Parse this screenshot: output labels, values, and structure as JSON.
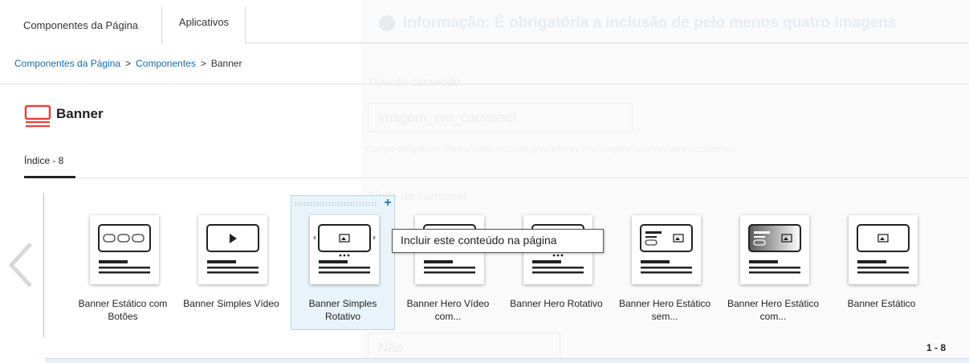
{
  "tabs": [
    {
      "label": "Componentes da Página"
    },
    {
      "label": "Aplicativos"
    }
  ],
  "breadcrumb": {
    "items": [
      "Componentes da Página",
      "Componentes"
    ],
    "current": "Banner",
    "separator": ">"
  },
  "page": {
    "title": "Banner",
    "index_label": "Índice - 8"
  },
  "carousel": {
    "items": [
      {
        "label": "Banner Estático com Botões",
        "icon": "banner-buttons-icon"
      },
      {
        "label": "Banner Simples Vídeo",
        "icon": "banner-video-icon"
      },
      {
        "label": "Banner Simples Rotativo",
        "icon": "banner-rotating-icon",
        "selected": true
      },
      {
        "label": "Banner Hero Vídeo com...",
        "icon": "banner-hero-video-icon"
      },
      {
        "label": "Banner Hero Rotativo",
        "icon": "banner-hero-rotating-icon"
      },
      {
        "label": "Banner Hero Estático sem...",
        "icon": "banner-hero-static-icon"
      },
      {
        "label": "Banner Hero Estático com...",
        "icon": "banner-hero-static-gradient-icon"
      },
      {
        "label": "Banner Estático",
        "icon": "banner-static-icon"
      }
    ],
    "pager": "1 - 8"
  },
  "tooltip": {
    "text": "Incluir este conteúdo na página"
  },
  "background_form": {
    "info": "Informação: É obrigatória a inclusão de pelo menos quatro imagens",
    "label1": "Tipo do conteúdo",
    "value1": "imagem_em_carrossel",
    "help": "Campo obrigatório. Para efetivar inclusão preencha as informações necessárias ao cadastrar",
    "label2": "Título do carrossel",
    "value2": "Não"
  },
  "colors": {
    "accent": "#1a6aa6",
    "brand_red": "#e8413c",
    "selected_bg": "#e9f4fa"
  }
}
